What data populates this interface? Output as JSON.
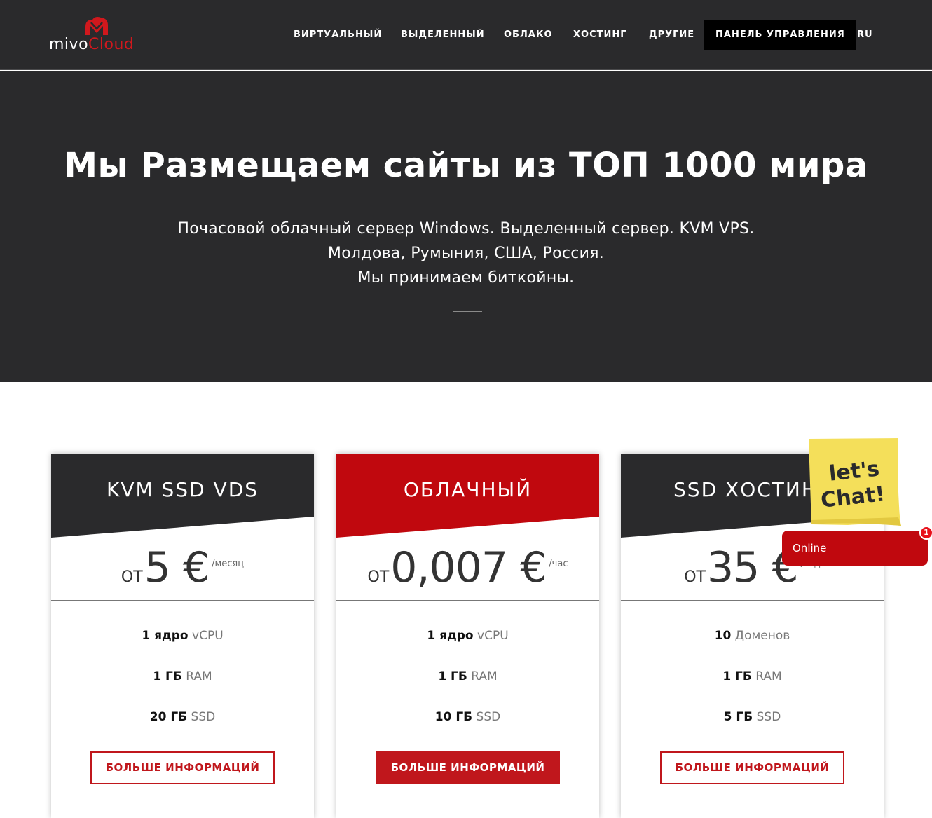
{
  "brand": {
    "logo_part1": "mivo",
    "logo_part2": "Cloud",
    "accent_color": "#c0171c",
    "dark_color": "#2a2a2c"
  },
  "nav": {
    "items": [
      {
        "label": "ВИРТУАЛЬНЫЙ"
      },
      {
        "label": "ВЫДЕЛЕННЫЙ"
      },
      {
        "label": "ОБЛАКО"
      },
      {
        "label": "ХОСТИНГ"
      },
      {
        "label": "ДРУГИЕ"
      },
      {
        "label": "ПАНЕЛЬ УПРАВЛЕНИЯ"
      },
      {
        "label": "RU"
      }
    ],
    "active_item": "ПАНЕЛЬ УПРАВЛЕНИЯ"
  },
  "hero": {
    "title": "Мы Размещаем сайты из ТОП 1000 мира",
    "lines": [
      "Почасовой облачный сервер Windows. Выделенный сервер. KVM VPS.",
      "Молдова, Румыния, США, Россия.",
      "Мы принимаем биткойны."
    ]
  },
  "plans": [
    {
      "title": "KVM SSD VDS",
      "from": "ОТ",
      "price": "5 €",
      "unit": "/месяц",
      "features": [
        {
          "value": "1 ядро",
          "label": "vCPU"
        },
        {
          "value": "1 ГБ",
          "label": "RAM"
        },
        {
          "value": "20 ГБ",
          "label": "SSD"
        }
      ],
      "button": "БОЛЬШЕ ИНФОРМАЦИЙ",
      "button_style": "outline",
      "header_color": "#2a2a2c"
    },
    {
      "title": "ОБЛАЧНЫЙ",
      "from": "ОТ",
      "price": "0,007 €",
      "unit": "/час",
      "features": [
        {
          "value": "1 ядро",
          "label": "vCPU"
        },
        {
          "value": "1 ГБ",
          "label": "RAM"
        },
        {
          "value": "10 ГБ",
          "label": "SSD"
        }
      ],
      "button": "БОЛЬШЕ ИНФОРМАЦИЙ",
      "button_style": "filled",
      "header_color": "#c0080e"
    },
    {
      "title": "SSD ХОСТИНГ",
      "from": "ОТ",
      "price": "35 €",
      "unit": "/год",
      "features": [
        {
          "value": "10",
          "label": "Доменов"
        },
        {
          "value": "1 ГБ",
          "label": "RAM"
        },
        {
          "value": "5 ГБ",
          "label": "SSD"
        }
      ],
      "button": "БОЛЬШЕ ИНФОРМАЦИЙ",
      "button_style": "outline",
      "header_color": "#2a2a2c"
    }
  ],
  "chat": {
    "note_line1": "let's",
    "note_line2": "Chat!",
    "status": "Online",
    "badge_count": "1"
  }
}
